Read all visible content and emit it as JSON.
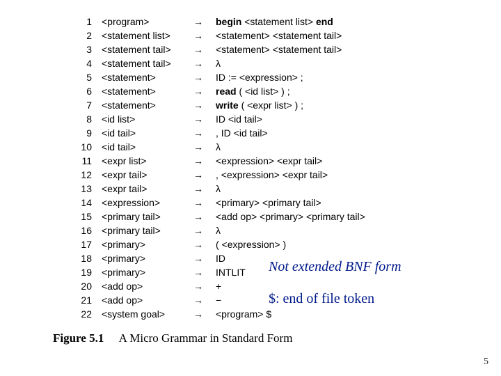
{
  "rules": [
    {
      "n": "1",
      "lhs": "<program>",
      "rhs_html": "<span class='bold'>begin</span> &lt;statement list&gt; <span class='bold'>end</span>"
    },
    {
      "n": "2",
      "lhs": "<statement list>",
      "rhs_html": "&lt;statement&gt; &lt;statement tail&gt;"
    },
    {
      "n": "3",
      "lhs": "<statement tail>",
      "rhs_html": "&lt;statement&gt; &lt;statement tail&gt;"
    },
    {
      "n": "4",
      "lhs": "<statement tail>",
      "rhs_html": "λ"
    },
    {
      "n": "5",
      "lhs": "<statement>",
      "rhs_html": "ID := &lt;expression&gt; ;"
    },
    {
      "n": "6",
      "lhs": "<statement>",
      "rhs_html": "<span class='bold'>read</span> ( &lt;id list&gt; ) ;"
    },
    {
      "n": "7",
      "lhs": "<statement>",
      "rhs_html": "<span class='bold'>write</span> ( &lt;expr list&gt; ) ;"
    },
    {
      "n": "8",
      "lhs": "<id list>",
      "rhs_html": "ID &lt;id tail&gt;"
    },
    {
      "n": "9",
      "lhs": "<id tail>",
      "rhs_html": ", ID &lt;id tail&gt;"
    },
    {
      "n": "10",
      "lhs": "<id tail>",
      "rhs_html": "λ"
    },
    {
      "n": "11",
      "lhs": "<expr list>",
      "rhs_html": "&lt;expression&gt; &lt;expr tail&gt;"
    },
    {
      "n": "12",
      "lhs": "<expr tail>",
      "rhs_html": ", &lt;expression&gt; &lt;expr tail&gt;"
    },
    {
      "n": "13",
      "lhs": "<expr tail>",
      "rhs_html": "λ"
    },
    {
      "n": "14",
      "lhs": "<expression>",
      "rhs_html": "&lt;primary&gt; &lt;primary tail&gt;"
    },
    {
      "n": "15",
      "lhs": "<primary tail>",
      "rhs_html": "&lt;add op&gt; &lt;primary&gt; &lt;primary tail&gt;"
    },
    {
      "n": "16",
      "lhs": "<primary tail>",
      "rhs_html": "λ"
    },
    {
      "n": "17",
      "lhs": "<primary>",
      "rhs_html": "( &lt;expression&gt; )"
    },
    {
      "n": "18",
      "lhs": "<primary>",
      "rhs_html": "ID"
    },
    {
      "n": "19",
      "lhs": "<primary>",
      "rhs_html": "INTLIT"
    },
    {
      "n": "20",
      "lhs": "<add op>",
      "rhs_html": "+"
    },
    {
      "n": "21",
      "lhs": "<add op>",
      "rhs_html": "&minus;"
    },
    {
      "n": "22",
      "lhs": "<system goal>",
      "rhs_html": "&lt;program&gt; $"
    }
  ],
  "arrow": "→",
  "note1": "Not extended BNF form",
  "note2": "$: end of file token",
  "caption_label": "Figure 5.1",
  "caption_text": "A Micro Grammar in Standard Form",
  "page_number": "5"
}
